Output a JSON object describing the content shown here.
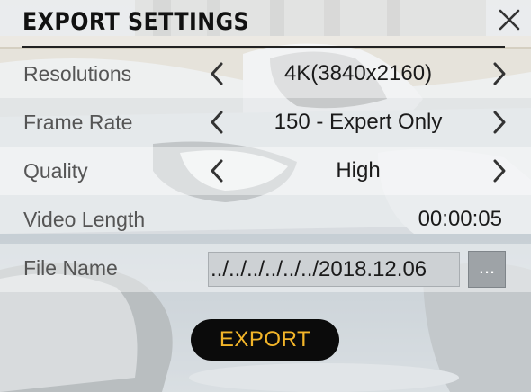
{
  "dialog": {
    "title": "EXPORT SETTINGS",
    "close_icon": "close-icon"
  },
  "settings": {
    "resolution": {
      "label": "Resolutions",
      "value": "4K(3840x2160)"
    },
    "frame_rate": {
      "label": "Frame Rate",
      "value": "150 - Expert Only"
    },
    "quality": {
      "label": "Quality",
      "value": "High"
    },
    "video_length": {
      "label": "Video Length",
      "value": "00:00:05"
    },
    "file_name": {
      "label": "File Name",
      "value": "../../../../../../2018.12.06",
      "browse_label": "..."
    }
  },
  "actions": {
    "export_label": "EXPORT"
  },
  "colors": {
    "export_text": "#f3b529",
    "export_bg": "#0b0b0b",
    "title_text": "#111111"
  }
}
